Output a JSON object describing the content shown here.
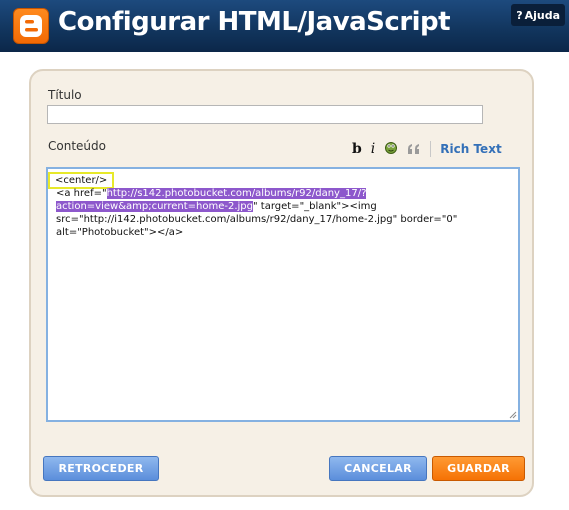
{
  "header": {
    "title": "Configurar HTML/JavaScript",
    "help_label": "Ajuda",
    "help_glyph": "?"
  },
  "form": {
    "title_label": "Título",
    "title_value": "",
    "content_label": "Conteúdo",
    "toolbar": {
      "bold": "b",
      "italic": "i",
      "quote": "❝",
      "rich_text": "Rich Text"
    },
    "content": {
      "line1_tag": "<center/>",
      "line2_prefix": "<a href=\"",
      "line2_highlight": "http://s142.photobucket.com/albums/r92/dany_17/?",
      "line3_highlight": "action=view&amp;current=home-2.jpg",
      "line3_suffix": "\" target=\"_blank\"><img",
      "line4": "src=\"http://i142.photobucket.com/albums/r92/dany_17/home-2.jpg\" border=\"0\"",
      "line5": "alt=\"Photobucket\"></a>"
    }
  },
  "buttons": {
    "back": "RETROCEDER",
    "cancel": "CANCELAR",
    "save": "GUARDAR"
  },
  "colors": {
    "header_bg": "#12365f",
    "accent_orange": "#f57205",
    "button_blue": "#5b8edb",
    "selection_purple": "#8d58cc",
    "tag_outline_yellow": "#e7e92a",
    "link_blue": "#3370b8",
    "panel_bg": "#f6f0e6"
  },
  "icons": {
    "logo": "blogger-logo-icon",
    "spell": "spellcheck-icon",
    "quote": "blockquote-icon",
    "resize": "resize-grip-icon"
  }
}
